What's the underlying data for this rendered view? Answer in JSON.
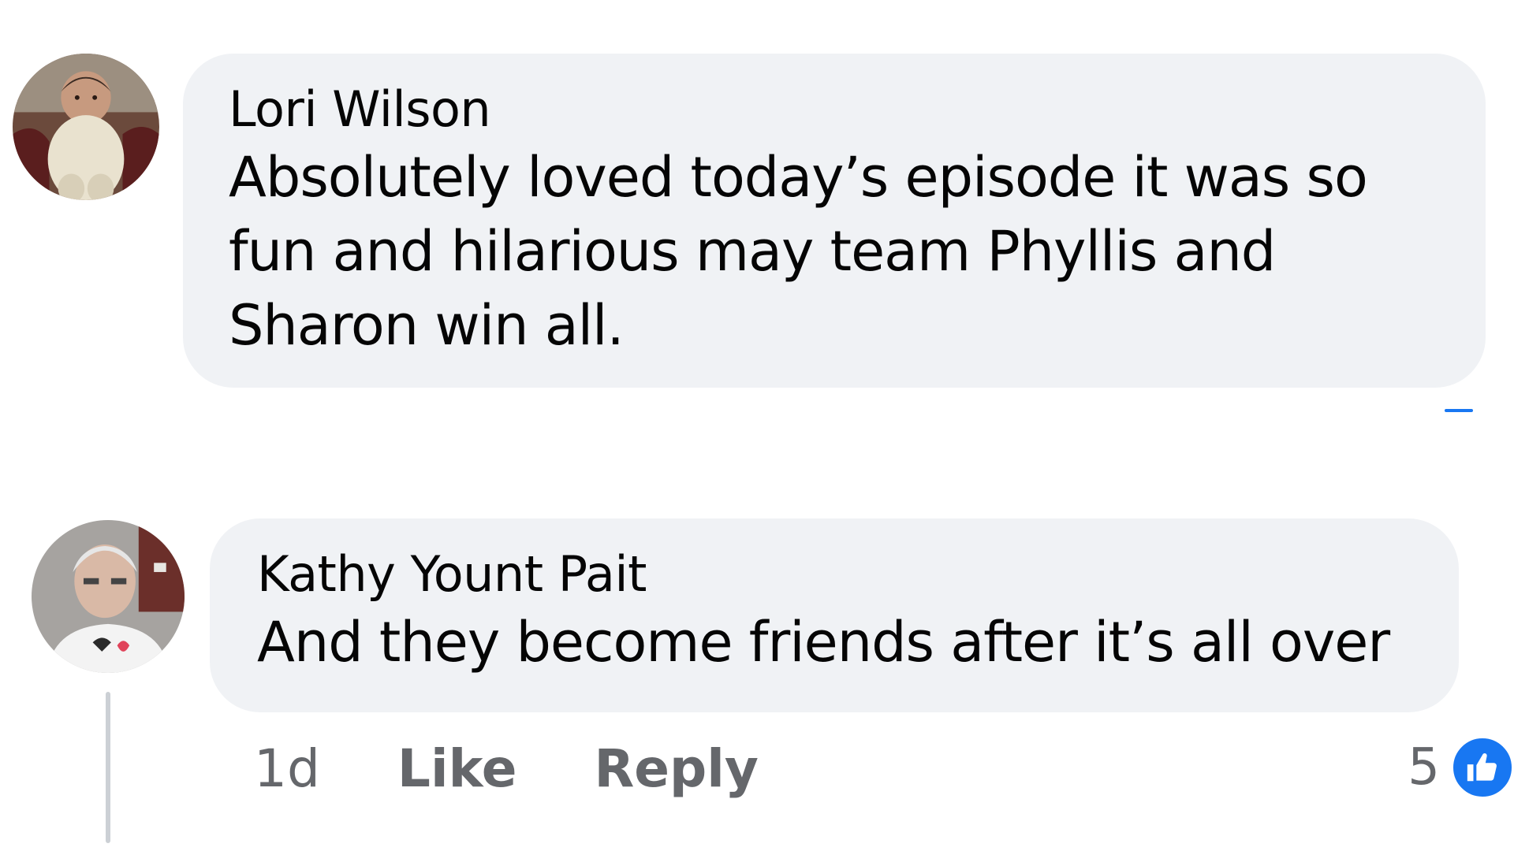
{
  "comments": [
    {
      "author": "Lori Wilson",
      "text": "Absolutely loved today’s episode it was so fun and hilarious may team Phyllis and Sharon win all.",
      "avatar_icon": "baby-photo-avatar"
    },
    {
      "author": "Kathy Yount Pait",
      "text": "And they become friends after it’s all over",
      "avatar_icon": "elderly-man-photo-avatar",
      "time": "1d",
      "like_label": "Like",
      "reply_label": "Reply",
      "reaction_count": "5",
      "reaction_icon": "thumbs-up-icon"
    }
  ],
  "colors": {
    "bubble": "#f0f2f5",
    "meta_text": "#65676b",
    "accent": "#1877f2",
    "thread_line": "#ccd0d5"
  }
}
